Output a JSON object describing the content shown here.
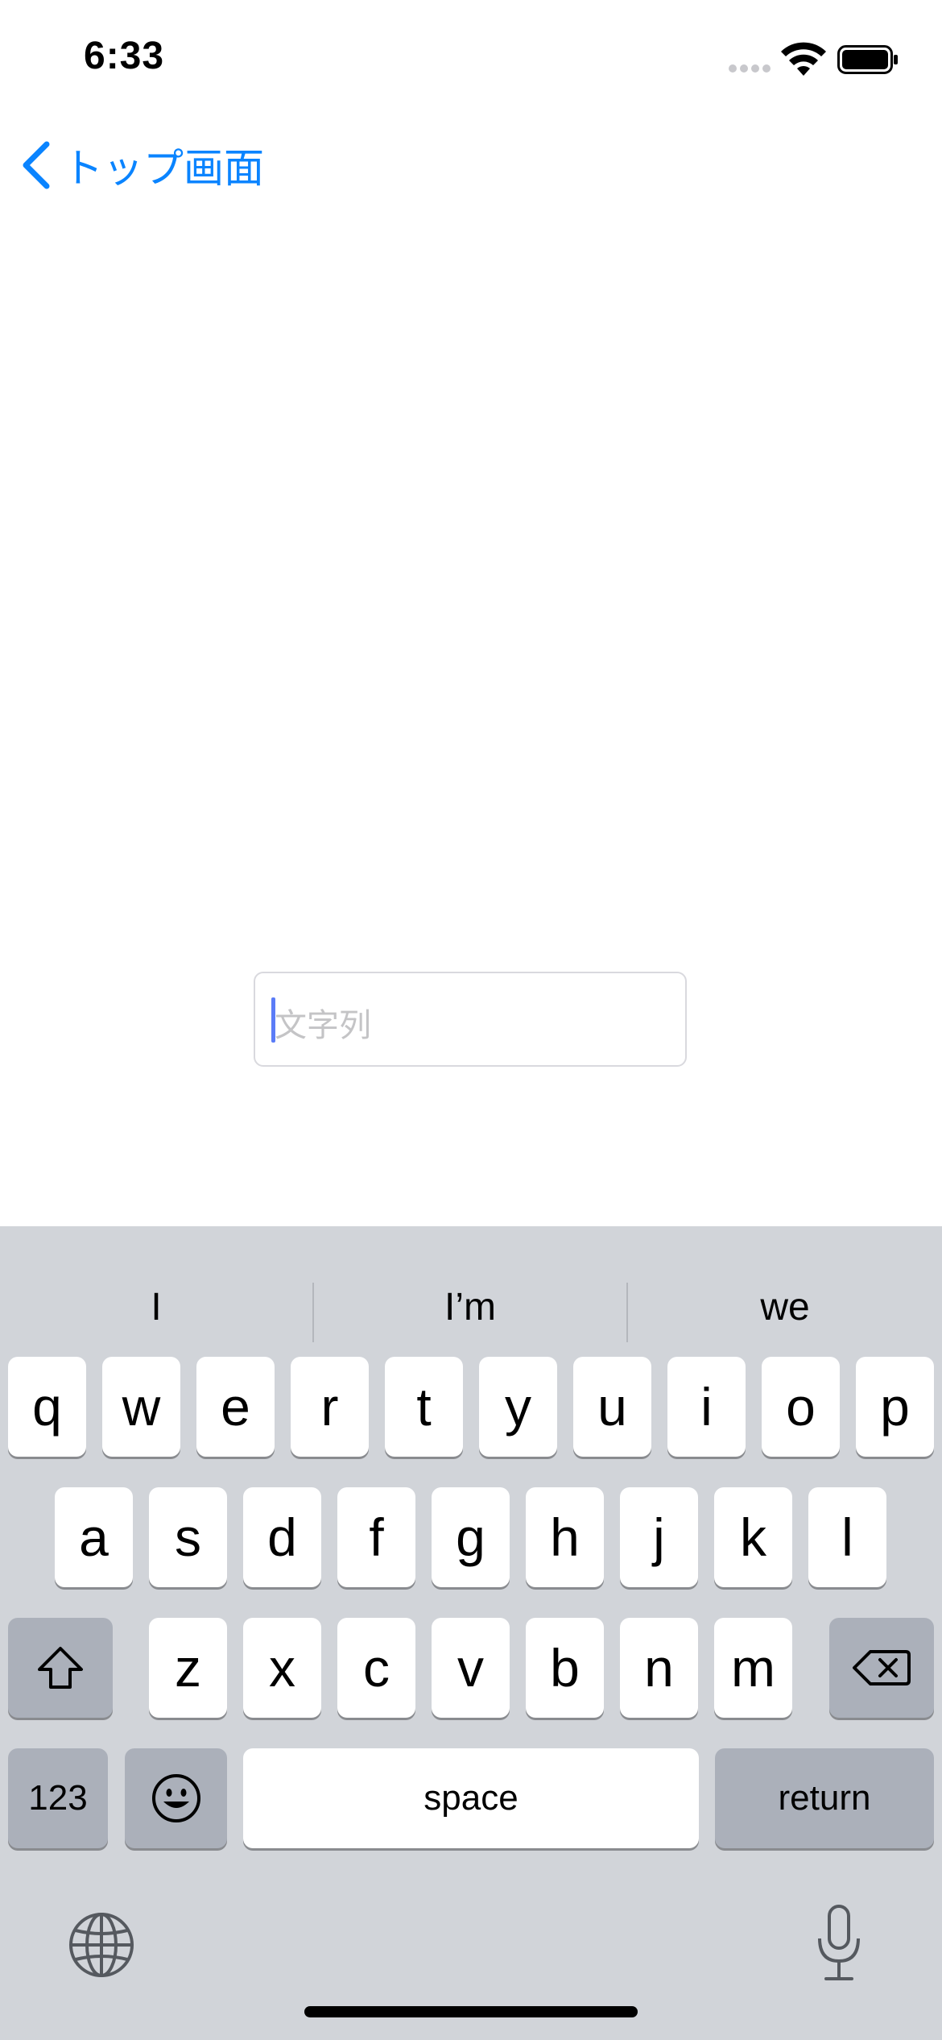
{
  "status_bar": {
    "time": "6:33"
  },
  "nav": {
    "back_label": "トップ画面"
  },
  "text_field": {
    "placeholder": "文字列",
    "value": ""
  },
  "keyboard": {
    "suggestions": [
      "I",
      "I’m",
      "we"
    ],
    "row1": [
      "q",
      "w",
      "e",
      "r",
      "t",
      "y",
      "u",
      "i",
      "o",
      "p"
    ],
    "row2": [
      "a",
      "s",
      "d",
      "f",
      "g",
      "h",
      "j",
      "k",
      "l"
    ],
    "row3": [
      "z",
      "x",
      "c",
      "v",
      "b",
      "n",
      "m"
    ],
    "numbers_label": "123",
    "space_label": "space",
    "return_label": "return",
    "icons": {
      "shift": "shift-icon",
      "delete": "delete-icon",
      "emoji": "emoji-icon",
      "globe": "globe-icon",
      "mic": "microphone-icon"
    }
  },
  "colors": {
    "accent": "#0a84ff",
    "keyboard_bg": "#d1d4d9",
    "dark_key": "#abb0ba"
  }
}
